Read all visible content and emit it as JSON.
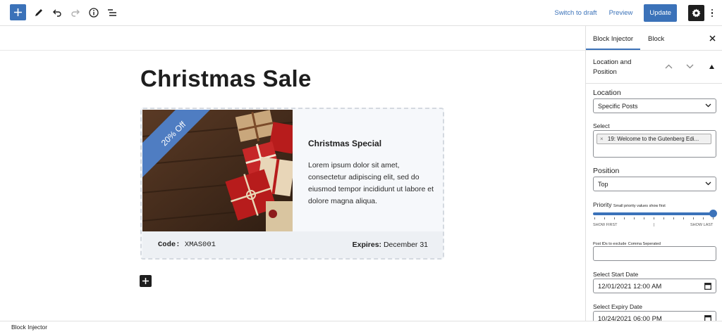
{
  "toolbar": {
    "add_icon": "plus-icon",
    "tools": [
      "pencil-icon",
      "undo-icon",
      "redo-icon",
      "info-icon",
      "list-view-icon"
    ],
    "switch_to_draft": "Switch to draft",
    "preview": "Preview",
    "update": "Update",
    "settings_icon": "gear-icon",
    "options_icon": "kebab-icon"
  },
  "post": {
    "title": "Christmas Sale",
    "promo": {
      "badge": "20% Off",
      "heading": "Christmas Special",
      "body": "Lorem ipsum dolor sit amet, consectetur adipiscing elit, sed do eiusmod tempor incididunt ut labore et dolore magna aliqua.",
      "code_label": "Code:",
      "code_value": "XMAS001",
      "expires_label": "Expires:",
      "expires_value": "December 31"
    }
  },
  "sidebar": {
    "tabs": [
      "Block Injector",
      "Block"
    ],
    "active_tab": "Block Injector",
    "panel_title": "Location and Position",
    "location_label": "Location",
    "location_value": "Specific Posts",
    "select_label": "Select",
    "selected_post": "19: Welcome to the Gutenberg Edi...",
    "position_label": "Position",
    "position_value": "Top",
    "priority_label": "Priority",
    "priority_hint": "Small priority values show first",
    "priority_level": 1.0,
    "priority_left": "SHOW FIRST",
    "priority_mid": "|",
    "priority_right": "SHOW LAST",
    "exclude_label": "Post IDs to exclude",
    "exclude_hint": "Comma Seperated",
    "exclude_value": "",
    "start_label": "Select Start Date",
    "start_value": "12/01/2021 12:00 AM",
    "expiry_label": "Select Expiry Date",
    "expiry_value": "10/24/2021 06:00 PM"
  },
  "footer": {
    "breadcrumb": "Block Injector"
  },
  "colors": {
    "accent": "#3b72b9",
    "dark": "#1e1e1e"
  }
}
